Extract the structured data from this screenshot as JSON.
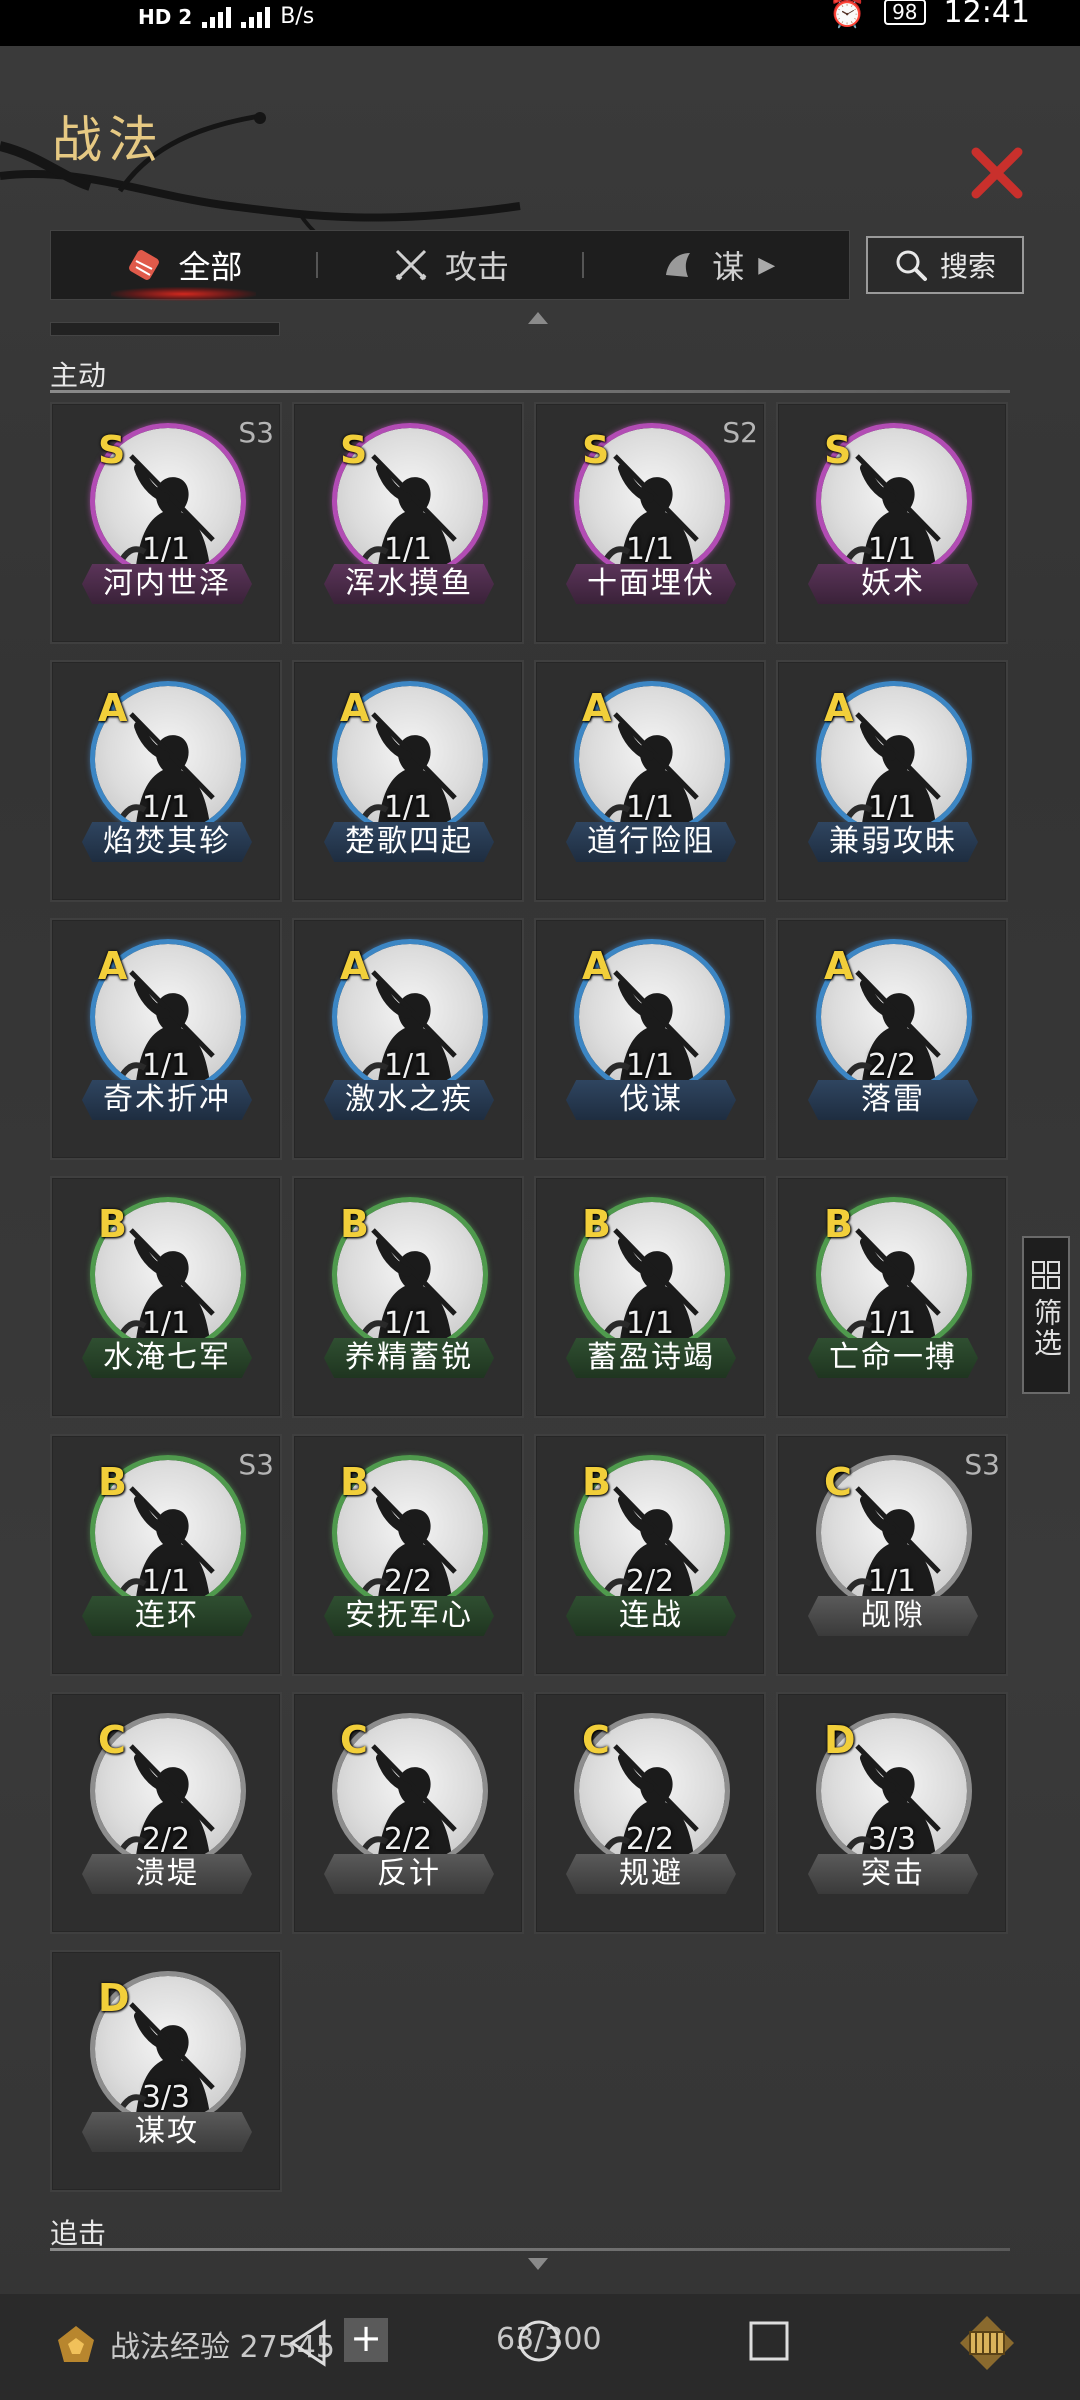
{
  "status_bar": {
    "network": "HD 2",
    "speed": "B/s",
    "battery": "98",
    "time": "12:41"
  },
  "panel": {
    "title": "战法"
  },
  "tabs": [
    {
      "label": "全部",
      "icon": "scroll-icon",
      "active": true
    },
    {
      "label": "攻击",
      "icon": "crossed-swords-icon",
      "active": false
    },
    {
      "label": "谋",
      "icon": "strategy-icon",
      "active": false
    }
  ],
  "search": {
    "label": "搜索"
  },
  "sections": {
    "active": "主动",
    "pursuit": "追击"
  },
  "filter": {
    "label": "筛选"
  },
  "cards": [
    {
      "grade": "S",
      "season": "S3",
      "count": "1/1",
      "name": "河内世泽",
      "tier": "purple"
    },
    {
      "grade": "S",
      "season": "",
      "count": "1/1",
      "name": "浑水摸鱼",
      "tier": "purple"
    },
    {
      "grade": "S",
      "season": "S2",
      "count": "1/1",
      "name": "十面埋伏",
      "tier": "purple"
    },
    {
      "grade": "S",
      "season": "",
      "count": "1/1",
      "name": "妖术",
      "tier": "purple"
    },
    {
      "grade": "A",
      "season": "",
      "count": "1/1",
      "name": "焰焚其轸",
      "tier": "blue"
    },
    {
      "grade": "A",
      "season": "",
      "count": "1/1",
      "name": "楚歌四起",
      "tier": "blue"
    },
    {
      "grade": "A",
      "season": "",
      "count": "1/1",
      "name": "道行险阻",
      "tier": "blue"
    },
    {
      "grade": "A",
      "season": "",
      "count": "1/1",
      "name": "兼弱攻昧",
      "tier": "blue"
    },
    {
      "grade": "A",
      "season": "",
      "count": "1/1",
      "name": "奇术折冲",
      "tier": "blue"
    },
    {
      "grade": "A",
      "season": "",
      "count": "1/1",
      "name": "激水之疾",
      "tier": "blue"
    },
    {
      "grade": "A",
      "season": "",
      "count": "1/1",
      "name": "伐谋",
      "tier": "blue"
    },
    {
      "grade": "A",
      "season": "",
      "count": "2/2",
      "name": "落雷",
      "tier": "blue"
    },
    {
      "grade": "B",
      "season": "",
      "count": "1/1",
      "name": "水淹七军",
      "tier": "green"
    },
    {
      "grade": "B",
      "season": "",
      "count": "1/1",
      "name": "养精蓄锐",
      "tier": "green"
    },
    {
      "grade": "B",
      "season": "",
      "count": "1/1",
      "name": "蓄盈诗竭",
      "tier": "green"
    },
    {
      "grade": "B",
      "season": "",
      "count": "1/1",
      "name": "亡命一搏",
      "tier": "green"
    },
    {
      "grade": "B",
      "season": "S3",
      "count": "1/1",
      "name": "连环",
      "tier": "green"
    },
    {
      "grade": "B",
      "season": "",
      "count": "2/2",
      "name": "安抚军心",
      "tier": "green"
    },
    {
      "grade": "B",
      "season": "",
      "count": "2/2",
      "name": "连战",
      "tier": "green"
    },
    {
      "grade": "C",
      "season": "S3",
      "count": "1/1",
      "name": "觇隙",
      "tier": "gray"
    },
    {
      "grade": "C",
      "season": "",
      "count": "2/2",
      "name": "溃堤",
      "tier": "gray"
    },
    {
      "grade": "C",
      "season": "",
      "count": "2/2",
      "name": "反计",
      "tier": "gray"
    },
    {
      "grade": "C",
      "season": "",
      "count": "2/2",
      "name": "规避",
      "tier": "gray"
    },
    {
      "grade": "D",
      "season": "",
      "count": "3/3",
      "name": "突击",
      "tier": "gray"
    },
    {
      "grade": "D",
      "season": "",
      "count": "3/3",
      "name": "谋攻",
      "tier": "gray"
    }
  ],
  "bottom": {
    "exp_label": "战法经验 27545",
    "plus": "+",
    "capacity": "63/300"
  },
  "colors": {
    "title": "#e6c983",
    "grade": "#f2cf3a",
    "close": "#c9302c",
    "purple": "#b24cb4",
    "blue": "#3c86c4",
    "green": "#4f9a4d",
    "gray": "#8d8d8d"
  }
}
